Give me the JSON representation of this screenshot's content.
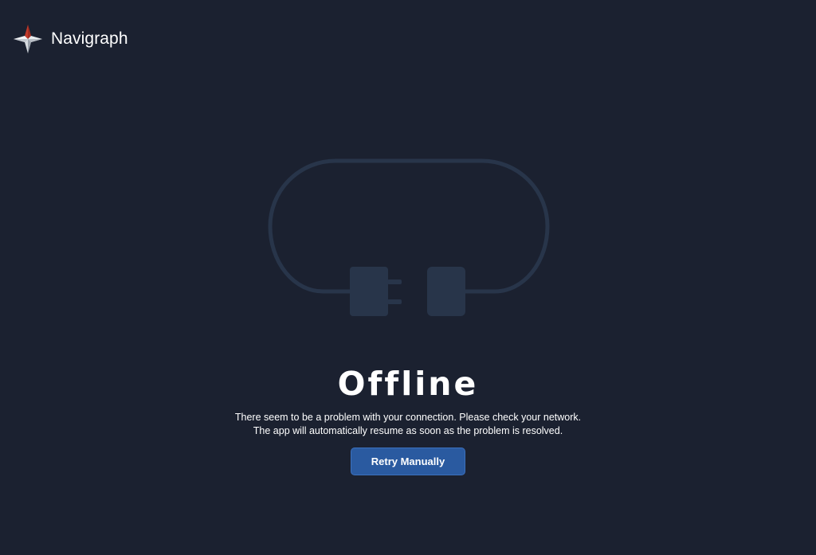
{
  "brand": {
    "name": "Navigraph"
  },
  "offline": {
    "title": "Offline",
    "message_line1": "There seem to be a problem with your connection. Please check your network.",
    "message_line2": "The app will automatically resume as soon as the problem is resolved.",
    "retry_label": "Retry Manually"
  },
  "icons": {
    "logo": "navigraph-compass-star-icon",
    "illustration": "unplugged-cable-icon"
  },
  "colors": {
    "background": "#1b2130",
    "illustration": "#28354a",
    "button": "#2a5aa0",
    "logo_accent": "#c23a2b"
  }
}
